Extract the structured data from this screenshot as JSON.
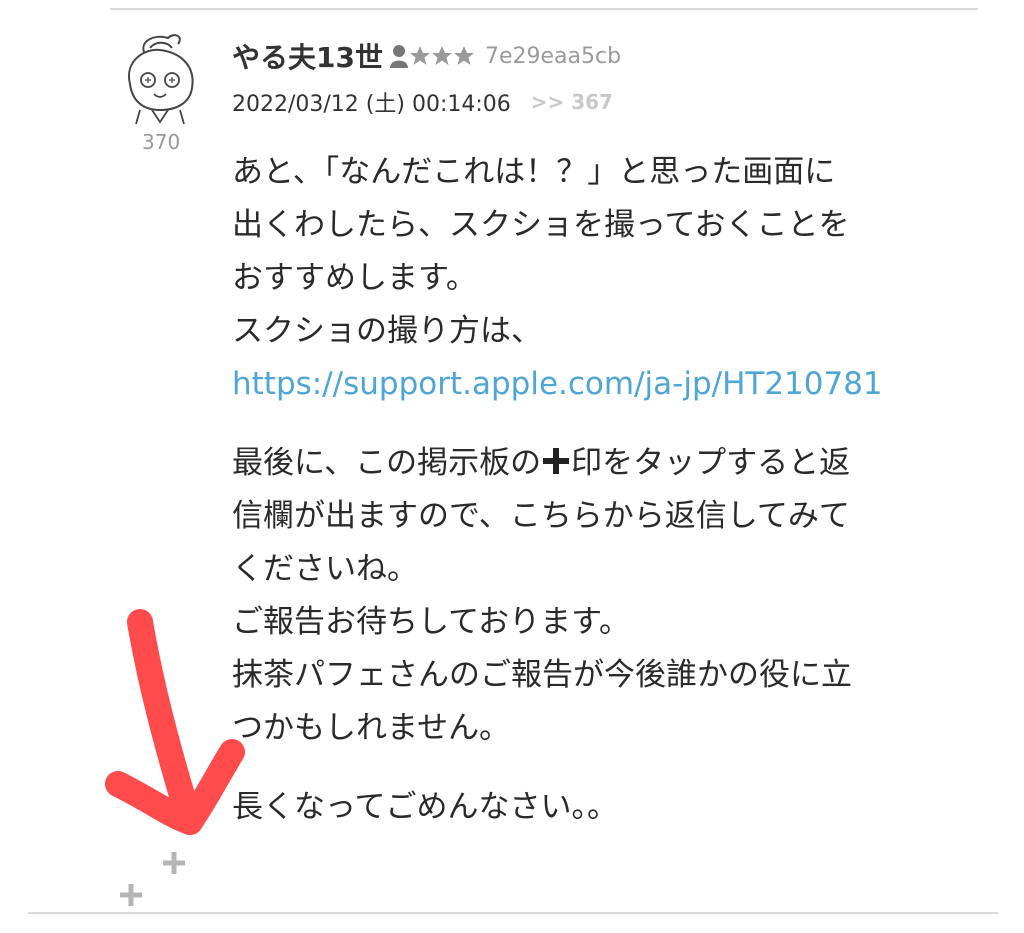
{
  "post": {
    "username": "やる夫13世",
    "user_id": "7e29eaa5cb",
    "timestamp": "2022/03/12 (土) 00:14:06",
    "reply_to": ">> 367",
    "post_number": "370",
    "rank_stars": 3,
    "lines": [
      "あと、「なんだこれは！？」と思った画面に",
      "出くわしたら、スクショを撮っておくことを",
      "おすすめします。",
      "スクショの撮り方は、"
    ],
    "link": "https://support.apple.com/ja-jp/HT210781",
    "plus_line_before": "最後に、この掲示板の",
    "plus_line_after": "印をタップすると返",
    "lines2": [
      "信欄が出ますので、こちらから返信してみて",
      "くださいね。",
      "ご報告お待ちしております。",
      "抹茶パフェさんのご報告が今後誰かの役に立",
      "つかもしれません。"
    ],
    "closing": "長くなってごめんなさい。。"
  },
  "colors": {
    "link": "#4ea5d6",
    "annotation": "#ff4b4b",
    "muted": "#999999"
  }
}
